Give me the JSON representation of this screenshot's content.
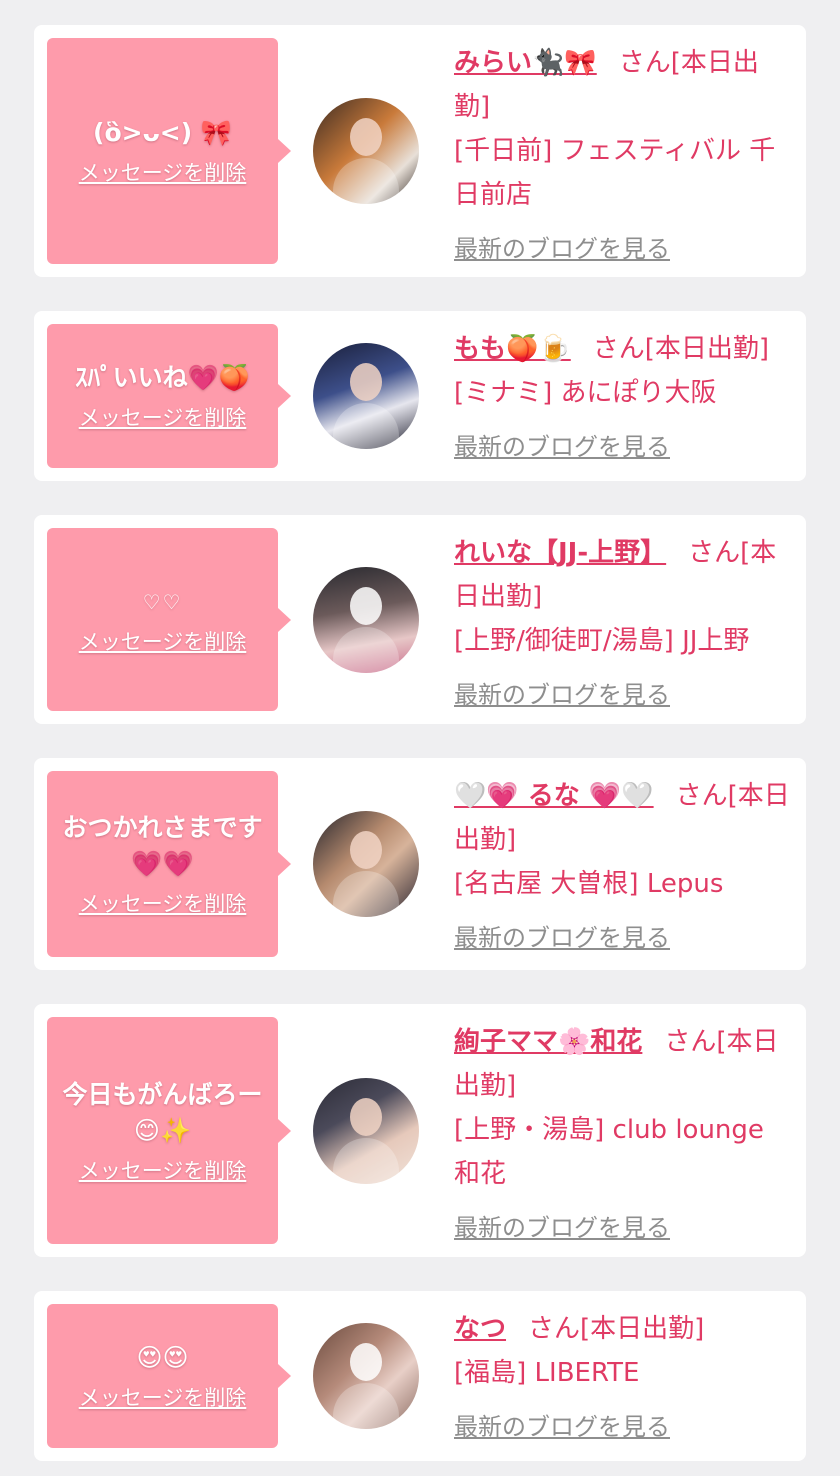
{
  "cards": [
    {
      "message": "(ὃ>ᴗ<) 🎀",
      "delete_label": "メッセージを削除",
      "avatar": "avatar-photo",
      "name": "みらい🐈‍⬛🎀",
      "honorific": "さん[本日出勤]",
      "location": "[千日前] フェスティバル 千日前店",
      "blog_link": "最新のブログを見る"
    },
    {
      "message": "ｽﾊﾟいいね💗🍑",
      "delete_label": "メッセージを削除",
      "avatar": "avatar-photo",
      "name": "もも🍑🍺",
      "honorific": "さん[本日出勤]",
      "location": "[ミナミ] あにぽり大阪",
      "blog_link": "最新のブログを見る"
    },
    {
      "message": "♡♡",
      "delete_label": "メッセージを削除",
      "avatar": "avatar-photo",
      "name": "れいな【JJ-上野】",
      "honorific": "さん[本日出勤]",
      "location": "[上野/御徒町/湯島] JJ上野",
      "blog_link": "最新のブログを見る"
    },
    {
      "message": "おつかれさまです💗💗",
      "delete_label": "メッセージを削除",
      "avatar": "avatar-photo",
      "name": "🤍💗 るな 💗🤍",
      "honorific": "さん[本日出勤]",
      "location": "[名古屋 大曽根] Lepus",
      "blog_link": "最新のブログを見る"
    },
    {
      "message": "今日もがんばろー😊✨",
      "delete_label": "メッセージを削除",
      "avatar": "avatar-photo",
      "name": "絢子ママ🌸和花",
      "honorific": "さん[本日出勤]",
      "location": "[上野・湯島] club lounge 和花",
      "blog_link": "最新のブログを見る"
    },
    {
      "message": "😍😍",
      "delete_label": "メッセージを削除",
      "avatar": "avatar-photo",
      "name": "なつ",
      "honorific": "さん[本日出勤]",
      "location": "[福島] LIBERTE",
      "blog_link": "最新のブログを見る"
    }
  ],
  "colors": {
    "bubble": "#fe9bab",
    "name_text": "#e03a64",
    "blog_link": "#8e8e8e",
    "page_bg": "#efeff1"
  }
}
